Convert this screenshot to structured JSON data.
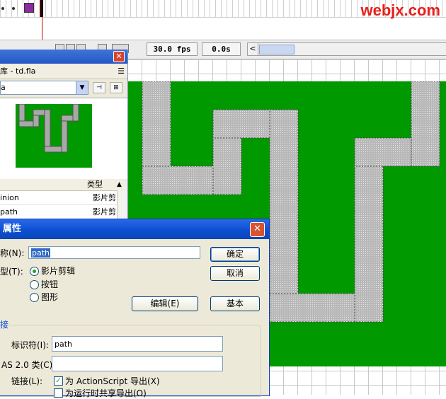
{
  "watermark": "webjx.com",
  "timeline": {
    "fps": "30.0 fps",
    "time": "0.0s",
    "scroll_left": "<"
  },
  "library": {
    "title": "库 - td.fla",
    "selected_library": "a",
    "column_type": "类型",
    "items": [
      {
        "name": "inion",
        "type": "影片剪"
      },
      {
        "name": "path",
        "type": "影片剪"
      }
    ]
  },
  "dialog": {
    "title": "属性",
    "name_label": "称(N):",
    "name_value": "path",
    "type_label": "型(T):",
    "types": [
      "影片剪辑",
      "按钮",
      "图形"
    ],
    "selected_type": "影片剪辑",
    "ok_label": "确定",
    "cancel_label": "取消",
    "edit_label": "编辑(E)",
    "basic_label": "基本",
    "linkage_group": "接",
    "identifier_label": "标识符(I):",
    "identifier_value": "path",
    "as_class_label": "AS 2.0 类(C):",
    "as_class_value": "",
    "linkage_label": "链接(L):",
    "export_as_label": "为 ActionScript 导出(X)",
    "export_as_checked": true,
    "export_runtime_label": "为运行时共享导出(O)",
    "export_runtime_checked": false
  },
  "colors": {
    "stage_green": "#009900",
    "path_gray": "#b8b8b8",
    "watermark_red": "#e8201c",
    "titlebar_blue": "#0a4fd0"
  }
}
